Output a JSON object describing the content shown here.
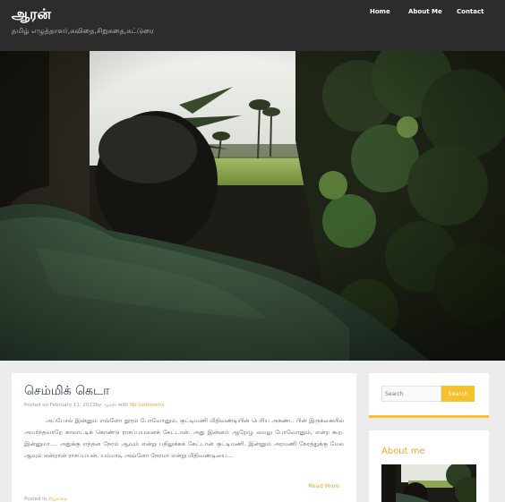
{
  "site": {
    "title": "ஆரன்",
    "tagline": "தமிழ் எழுத்தாளர்,கவிதை,சிறுகதை,கட்டுரை"
  },
  "nav": {
    "items": [
      {
        "label": "Home"
      },
      {
        "label": "About Me"
      },
      {
        "label": "Contact"
      }
    ]
  },
  "post": {
    "title": "செம்மிக் கெடா",
    "meta_posted_on": "Posted on",
    "meta_date": "February 11, 2022",
    "meta_by": "by",
    "meta_author": "ஆரன்",
    "meta_with": "with",
    "meta_comments": "No comments",
    "excerpt": "அப்போல் இன்னும் எவ்ளோ தூரம் போவோனும், குட்டிமணி மிதிவண்டியின் பெரிய அகண்ட பின் இருக்கையில் அமர்ந்தவாறே காலாட்டிக் கொண்டு ராசப்பயனைக் கேட்டான். அது இன்னம் ஆறேழு மைலு போவோனும், என்ற கூற. இன்னுமா.... அதுக்கு எத்தன நேரம் ஆவும் என்று பதிலுக்கக் கேட்டான் குட்டிமணி. இன்னும் அரமணி நேரத்துக்கு மேல ஆவும் என்றான் ராசப்பயன்.    யம்மாடி அவ்ளோ நேரமா என்று மிதிவண்டியை...",
    "read_more": "Read More",
    "posted_in_label": "Posted in",
    "category": "சிறுகதை"
  },
  "sidebar": {
    "search_placeholder": "Search",
    "search_button": "Search",
    "about_title": "About me"
  },
  "colors": {
    "header_bg": "#2c2c2c",
    "accent": "#f6c22c",
    "link": "#f0a72e",
    "page_bg": "#ececec"
  }
}
